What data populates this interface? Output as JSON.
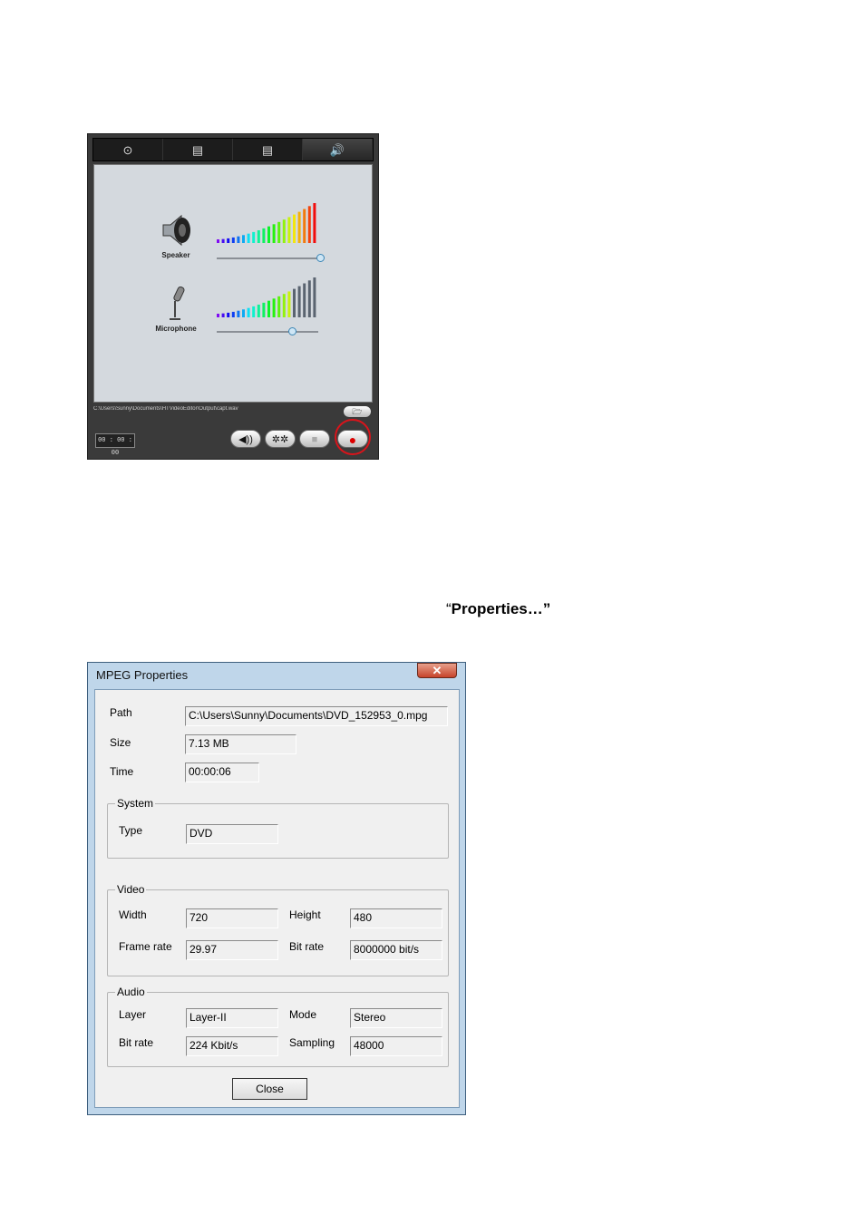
{
  "capture_panel": {
    "tabs": [
      {
        "icon": "webcam-icon",
        "glyph": "⊙"
      },
      {
        "icon": "tv-icon",
        "glyph": "▤"
      },
      {
        "icon": "hdtv-icon",
        "glyph": "▤"
      },
      {
        "icon": "audio-speaker-icon",
        "glyph": "🔊"
      }
    ],
    "speaker": {
      "label": "Speaker",
      "volume": 1.0
    },
    "microphone": {
      "label": "Microphone",
      "volume": 0.74
    },
    "output_path": "C:\\Users\\Sunny\\Documents\\HTVideoEditor\\Output\\capt.wav",
    "timer": "00 : 00 : 00",
    "controls": [
      {
        "name": "volume-button",
        "glyph": "◀))"
      },
      {
        "name": "settings-button",
        "glyph": "✲✲"
      },
      {
        "name": "stop-button",
        "glyph": "■"
      },
      {
        "name": "record-button",
        "glyph": "●"
      }
    ]
  },
  "caption": {
    "open_quote": "“",
    "text": "Properties…”"
  },
  "dialog": {
    "title": "MPEG Properties",
    "close_glyph": "✕",
    "path_label": "Path",
    "path_value": "C:\\Users\\Sunny\\Documents\\DVD_152953_0.mpg",
    "size_label": "Size",
    "size_value": "7.13 MB",
    "time_label": "Time",
    "time_value": "00:00:06",
    "system": {
      "title": "System",
      "type_label": "Type",
      "type_value": "DVD"
    },
    "video": {
      "title": "Video",
      "width_label": "Width",
      "width_value": "720",
      "height_label": "Height",
      "height_value": "480",
      "framerate_label": "Frame rate",
      "framerate_value": "29.97",
      "bitrate_label": "Bit rate",
      "bitrate_value": "8000000 bit/s"
    },
    "audio": {
      "title": "Audio",
      "layer_label": "Layer",
      "layer_value": "Layer-II",
      "mode_label": "Mode",
      "mode_value": "Stereo",
      "bitrate_label": "Bit rate",
      "bitrate_value": "224 Kbit/s",
      "sampling_label": "Sampling",
      "sampling_value": "48000"
    },
    "close_button": "Close"
  }
}
